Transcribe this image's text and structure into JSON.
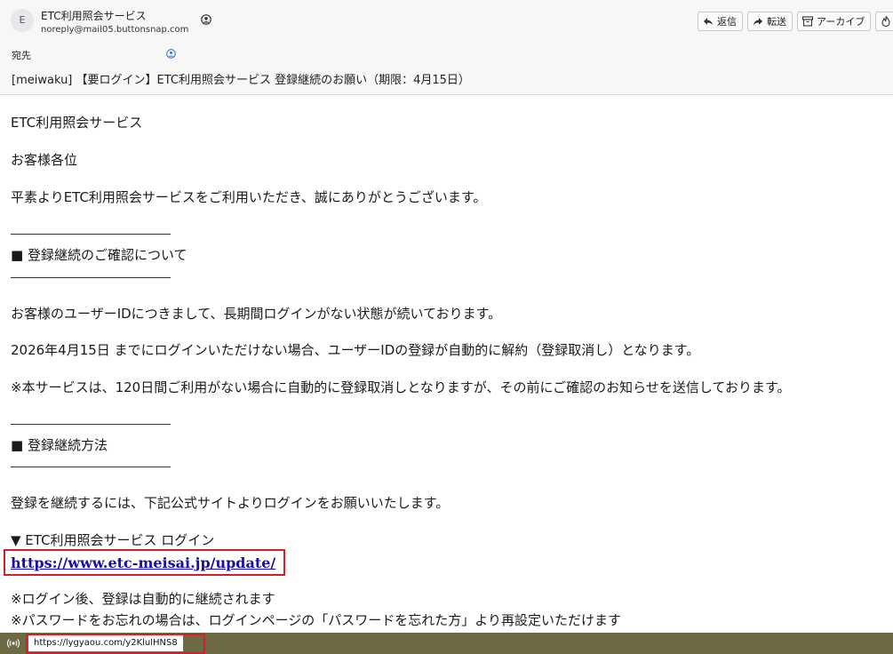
{
  "header": {
    "avatar_letter": "E",
    "sender_name": "ETC利用照会サービス",
    "sender_email": "noreply@mail05.buttonsnap.com",
    "to_label": "宛先",
    "subject": "[meiwaku] 【要ログイン】ETC利用照会サービス 登録継続のお願い（期限：4月15日）"
  },
  "toolbar": {
    "reply": "返信",
    "forward": "転送",
    "archive": "アーカイブ",
    "junk": "迷"
  },
  "body": {
    "service_name": "ETC利用照会サービス",
    "greeting": "お客様各位",
    "intro": "平素よりETC利用照会サービスをご利用いただき、誠にありがとうございます。",
    "section1_title": "■ 登録継続のご確認について",
    "para1": "お客様のユーザーIDにつきまして、長期間ログインがない状態が続いております。",
    "para2": "2026年4月15日 までにログインいただけない場合、ユーザーIDの登録が自動的に解約（登録取消し）となります。",
    "para3": "※本サービスは、120日間ご利用がない場合に自動的に登録取消しとなりますが、その前にご確認のお知らせを送信しております。",
    "section2_title": "■ 登録継続方法",
    "para4": "登録を継続するには、下記公式サイトよりログインをお願いいたします。",
    "login_label": "▼ ETC利用照会サービス ログイン",
    "login_link": "https://www.etc-meisai.jp/update/",
    "note1": "※ログイン後、登録は自動的に継続されます",
    "note2": "※パスワードをお忘れの場合は、ログインページの「パスワードを忘れた方」より再設定いただけます"
  },
  "statusbar": {
    "hover_url": "https://lygyaou.com/y2KlulHNS8"
  },
  "colors": {
    "highlight": "#d21f2b",
    "link": "#1a0dab"
  }
}
